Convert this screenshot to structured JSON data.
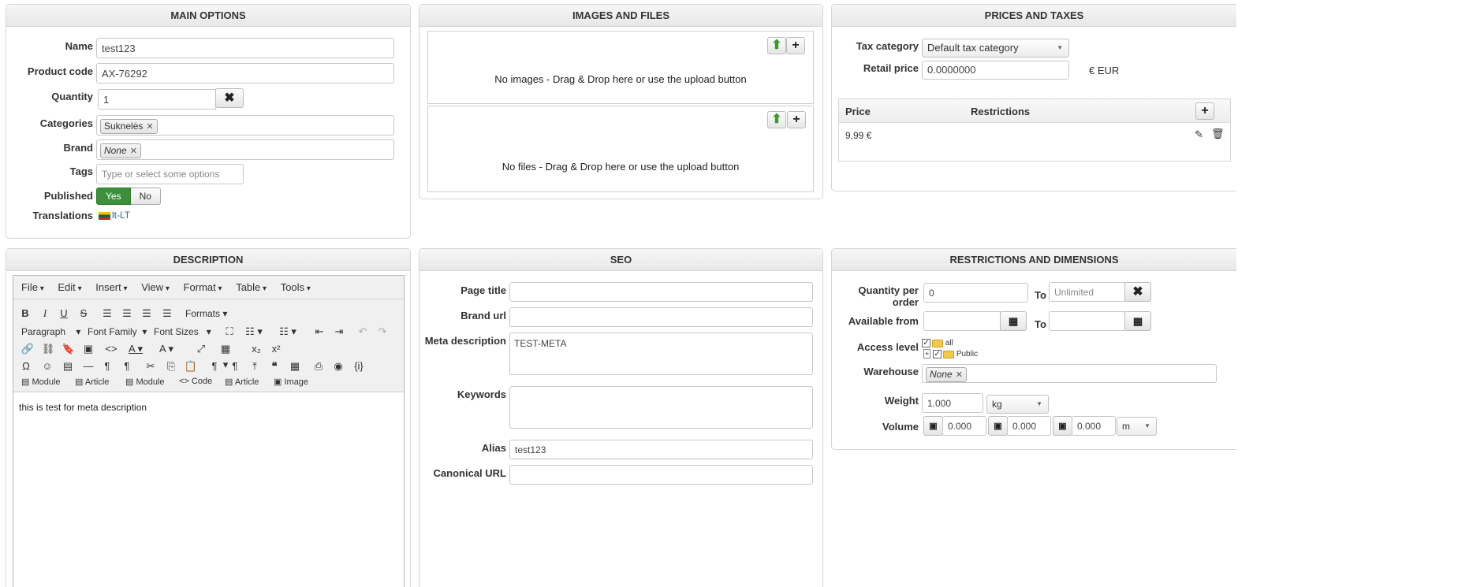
{
  "main_options": {
    "title": "MAIN OPTIONS",
    "name_label": "Name",
    "name_value": "test123",
    "code_label": "Product code",
    "code_value": "AX-76292",
    "qty_label": "Quantity",
    "qty_value": "1",
    "cat_label": "Categories",
    "cat_tag": "Suknelės",
    "brand_label": "Brand",
    "brand_tag": "None",
    "tags_label": "Tags",
    "tags_placeholder": "Type or select some options",
    "published_label": "Published",
    "yes": "Yes",
    "no": "No",
    "translations_label": "Translations",
    "translation_link": "lt-LT"
  },
  "images_files": {
    "title": "IMAGES AND FILES",
    "images_msg": "No images - Drag & Drop here or use the upload button",
    "files_msg": "No files - Drag & Drop here or use the upload button"
  },
  "prices": {
    "title": "PRICES AND TAXES",
    "tax_label": "Tax category",
    "tax_value": "Default tax category",
    "retail_label": "Retail price",
    "retail_value": "0.0000000",
    "currency": "€ EUR",
    "col_price": "Price",
    "col_restrictions": "Restrictions",
    "rows": [
      {
        "price": "9,99 €"
      }
    ]
  },
  "description": {
    "title": "DESCRIPTION",
    "menus": [
      "File",
      "Edit",
      "Insert",
      "View",
      "Format",
      "Table",
      "Tools"
    ],
    "formats": "Formats",
    "paragraph": "Paragraph",
    "font_family": "Font Family",
    "font_sizes": "Font Sizes",
    "bottom_buttons": [
      "Module",
      "Article",
      "Module",
      "Code",
      "Article",
      "Image"
    ],
    "content": "this is test for meta description"
  },
  "seo": {
    "title": "SEO",
    "page_title_label": "Page title",
    "page_title_value": "",
    "brand_url_label": "Brand url",
    "brand_url_value": "",
    "meta_desc_label": "Meta description",
    "meta_desc_value": "TEST-META",
    "keywords_label": "Keywords",
    "keywords_value": "",
    "alias_label": "Alias",
    "alias_value": "test123",
    "canonical_label": "Canonical URL",
    "canonical_value": ""
  },
  "restrictions": {
    "title": "RESTRICTIONS AND DIMENSIONS",
    "qty_label": "Quantity per order",
    "qty_from": "0",
    "to": "To",
    "qty_to_placeholder": "Unlimited",
    "available_label": "Available from",
    "access_label": "Access level",
    "access_all": "all",
    "access_public": "Public",
    "warehouse_label": "Warehouse",
    "warehouse_tag": "None",
    "weight_label": "Weight",
    "weight_value": "1.000",
    "weight_unit": "kg",
    "volume_label": "Volume",
    "vol1": "0.000",
    "vol2": "0.000",
    "vol3": "0.000",
    "volume_unit": "m"
  }
}
